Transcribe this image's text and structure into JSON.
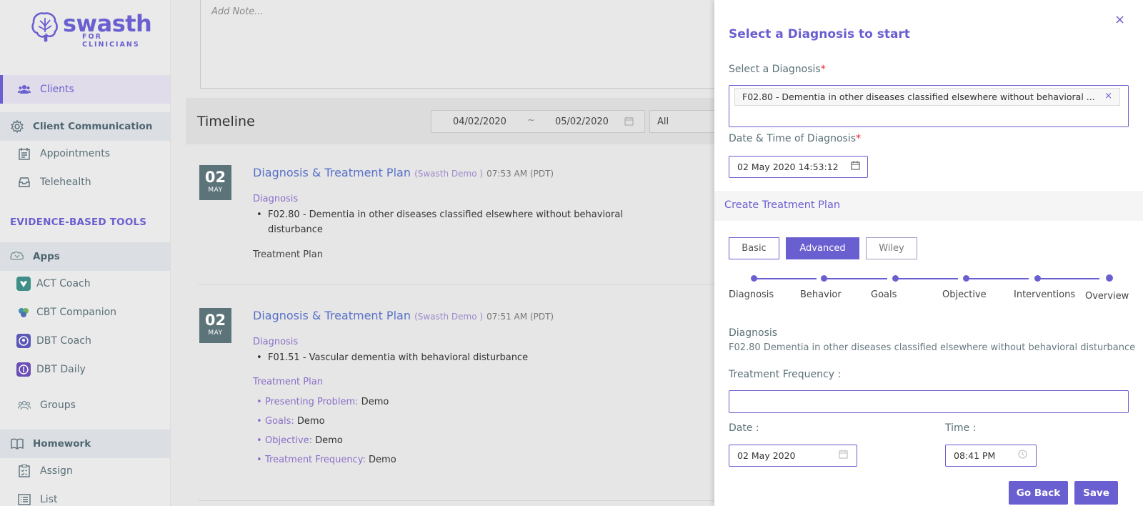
{
  "sidebar": {
    "brand": "swasth",
    "brand_sub": "FOR CLINICIANS",
    "clients": "Clients",
    "client_communication": "Client Communication",
    "appointments": "Appointments",
    "telehealth": "Telehealth",
    "evidence_based_tools": "EVIDENCE-BASED TOOLS",
    "apps": "Apps",
    "act_coach": "ACT Coach",
    "cbt_companion": "CBT Companion",
    "dbt_coach": "DBT Coach",
    "dbt_daily": "DBT Daily",
    "groups": "Groups",
    "homework": "Homework",
    "assign": "Assign",
    "list": "List"
  },
  "main": {
    "note_placeholder": "Add Note...",
    "timeline_title": "Timeline",
    "date_from": "04/02/2020",
    "date_sep": "~",
    "date_to": "05/02/2020",
    "filter_value": "All",
    "entries": [
      {
        "day": "02",
        "month": "MAY",
        "title": "Diagnosis & Treatment Plan",
        "by": "(Swasth Demo )",
        "time": "07:53 AM (PDT)",
        "diagnosis_label": "Diagnosis",
        "diagnosis_line1": "F02.80 - Dementia in other diseases classified elsewhere without behavioral",
        "diagnosis_line2": "disturbance",
        "treatment_label": "Treatment Plan"
      },
      {
        "day": "02",
        "month": "MAY",
        "title": "Diagnosis & Treatment Plan",
        "by": "(Swasth Demo )",
        "time": "07:51 AM (PDT)",
        "diagnosis_label": "Diagnosis",
        "diagnosis_line1": "F01.51 - Vascular dementia with behavioral disturbance",
        "treatment_label": "Treatment Plan",
        "plan": [
          {
            "k": "Presenting Problem:",
            "v": " Demo"
          },
          {
            "k": "Goals:",
            "v": "Demo"
          },
          {
            "k": "Objective:",
            "v": "Demo"
          },
          {
            "k": "Treatment Frequency:",
            "v": "Demo"
          }
        ]
      }
    ]
  },
  "drawer": {
    "title": "Select a Diagnosis to start",
    "select_label": "Select a Diagnosis",
    "required_mark": "*",
    "selected_tag": "F02.80 - Dementia in other diseases classified elsewhere without behavioral ...",
    "tag_remove": "×",
    "datetime_label": "Date & Time of Diagnosis",
    "datetime_value": "02 May 2020 14:53:12",
    "create_plan": "Create Treatment Plan",
    "tabs": [
      "Basic",
      "Advanced",
      "Wiley"
    ],
    "steps": [
      "Diagnosis",
      "Behavior",
      "Goals",
      "Objective",
      "Interventions",
      "Overview"
    ],
    "overview_label": "Diagnosis",
    "overview_value": "F02.80 Dementia in other diseases classified elsewhere without behavioral disturbance",
    "frequency_label": "Treatment Frequency :",
    "date_label": "Date :",
    "date_value": "02 May 2020",
    "time_label": "Time :",
    "time_value": "08:41 PM",
    "go_back": "Go Back",
    "save": "Save",
    "close": "×"
  },
  "colors": {
    "accent": "#6a5fd0",
    "badge": "#5c7479",
    "title_blue": "#5870c8"
  }
}
